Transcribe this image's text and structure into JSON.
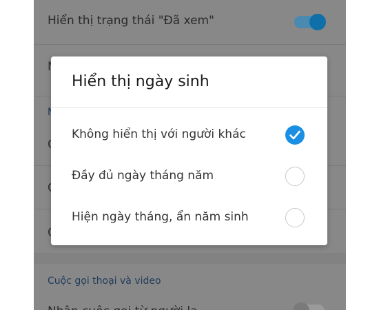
{
  "background_rows": {
    "seen_status_label": "Hiển thị trạng thái \"Đã xem\"",
    "row2_initial": "N",
    "section1_initial": "N",
    "row3_initial": "C",
    "row4_initial": "C",
    "row5_initial": "C",
    "section2_label": "Cuộc gọi thoại và video",
    "bottom_row_label": "Nhận cuộc gọi từ người lạ"
  },
  "dialog": {
    "title": "Hiển thị ngày sinh",
    "options": [
      {
        "label": "Không hiển thị với người khác",
        "selected": true
      },
      {
        "label": "Đầy đủ ngày tháng năm",
        "selected": false
      },
      {
        "label": "Hiện ngày tháng, ẩn năm sinh",
        "selected": false
      }
    ]
  },
  "colors": {
    "accent": "#1a8fe3",
    "overlay_bg": "#888888",
    "toggle_on_track": "#4a8ab0",
    "toggle_on_knob": "#0f6fa8",
    "toggle_off_track": "#9a9a9a",
    "toggle_off_knob": "#7a7a7a"
  },
  "icons": {
    "check": "check-icon"
  }
}
